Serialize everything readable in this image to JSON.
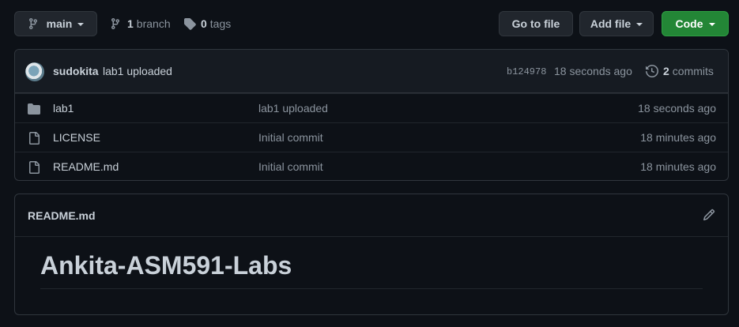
{
  "toolbar": {
    "branch_select": "main",
    "branches_count": "1",
    "branches_label": "branch",
    "tags_count": "0",
    "tags_label": "tags",
    "go_to_file": "Go to file",
    "add_file": "Add file",
    "code": "Code"
  },
  "commit": {
    "author": "sudokita",
    "message": "lab1 uploaded",
    "sha": "b124978",
    "time": "18 seconds ago",
    "commits_count": "2",
    "commits_label": "commits"
  },
  "files": [
    {
      "type": "folder",
      "name": "lab1",
      "message": "lab1 uploaded",
      "time": "18 seconds ago"
    },
    {
      "type": "file",
      "name": "LICENSE",
      "message": "Initial commit",
      "time": "18 minutes ago"
    },
    {
      "type": "file",
      "name": "README.md",
      "message": "Initial commit",
      "time": "18 minutes ago"
    }
  ],
  "readme": {
    "filename": "README.md",
    "heading": "Ankita-ASM591-Labs"
  },
  "colors": {
    "background": "#0d1117",
    "code_button": "#238636",
    "border": "#30363d"
  }
}
